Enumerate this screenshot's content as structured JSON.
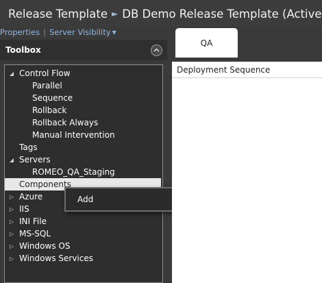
{
  "header": {
    "breadcrumb_root": "Release Template",
    "breadcrumb_current": "DB Demo Release Template (Active)"
  },
  "subnav": {
    "properties": "Properties",
    "server_visibility": "Server Visibility"
  },
  "toolbox": {
    "title": "Toolbox",
    "items": [
      {
        "label": "Control Flow",
        "expander": "expanded"
      },
      {
        "label": "Parallel"
      },
      {
        "label": "Sequence"
      },
      {
        "label": "Rollback"
      },
      {
        "label": "Rollback Always"
      },
      {
        "label": "Manual Intervention"
      },
      {
        "label": "Tags"
      },
      {
        "label": "Servers",
        "expander": "expanded"
      },
      {
        "label": "ROMEO_QA_Staging"
      },
      {
        "label": "Components",
        "selected": true
      },
      {
        "label": "Azure",
        "expander": "collapsed"
      },
      {
        "label": "IIS",
        "expander": "collapsed"
      },
      {
        "label": "INI File",
        "expander": "collapsed"
      },
      {
        "label": "MS-SQL",
        "expander": "collapsed"
      },
      {
        "label": "Windows OS",
        "expander": "collapsed"
      },
      {
        "label": "Windows Services",
        "expander": "collapsed"
      }
    ]
  },
  "context_menu": {
    "add": "Add"
  },
  "stage_tab": {
    "label": "QA"
  },
  "content": {
    "header": "Deployment Sequence"
  },
  "icons": {
    "title": "document-edit-icon",
    "collapse": "chevron-up-icon",
    "expanded": "triangle-down-icon",
    "collapsed": "triangle-right-icon"
  },
  "colors": {
    "link": "#8fb6e0",
    "selection": "#e8e8e8"
  }
}
